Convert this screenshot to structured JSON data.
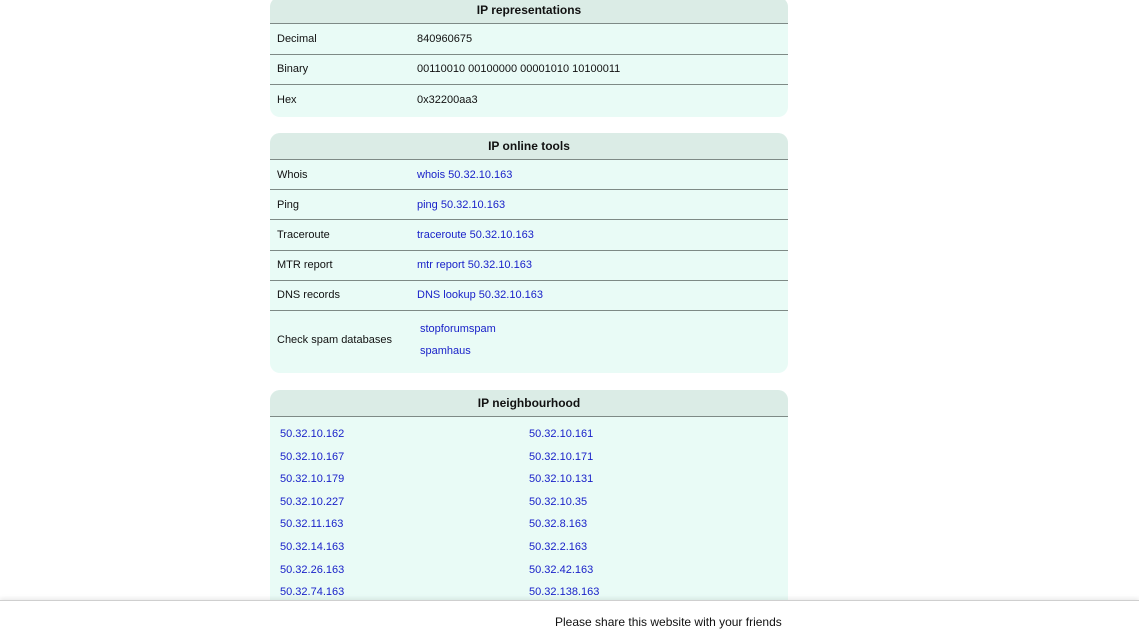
{
  "representations": {
    "title": "IP representations",
    "rows": [
      {
        "label": "Decimal",
        "value": "840960675"
      },
      {
        "label": "Binary",
        "value": "00110010 00100000 00001010 10100011"
      },
      {
        "label": "Hex",
        "value": "0x32200aa3"
      }
    ]
  },
  "tools": {
    "title": "IP online tools",
    "rows": [
      {
        "label": "Whois",
        "link": "whois 50.32.10.163"
      },
      {
        "label": "Ping",
        "link": "ping 50.32.10.163"
      },
      {
        "label": "Traceroute",
        "link": "traceroute 50.32.10.163"
      },
      {
        "label": "MTR report",
        "link": "mtr report 50.32.10.163"
      },
      {
        "label": "DNS records",
        "link": "DNS lookup 50.32.10.163"
      }
    ],
    "spam": {
      "label": "Check spam databases",
      "links": [
        "stopforumspam",
        "spamhaus"
      ]
    }
  },
  "neighbourhood": {
    "title": "IP neighbourhood",
    "items": [
      "50.32.10.162",
      "50.32.10.161",
      "50.32.10.167",
      "50.32.10.171",
      "50.32.10.179",
      "50.32.10.131",
      "50.32.10.227",
      "50.32.10.35",
      "50.32.11.163",
      "50.32.8.163",
      "50.32.14.163",
      "50.32.2.163",
      "50.32.26.163",
      "50.32.42.163",
      "50.32.74.163",
      "50.32.138.163"
    ]
  },
  "share_bar": {
    "text": "Please share this website with your friends"
  },
  "colors": {
    "panel_bg": "#e9fbf6",
    "header_bg": "#dbece6",
    "link": "#1a22c9"
  }
}
